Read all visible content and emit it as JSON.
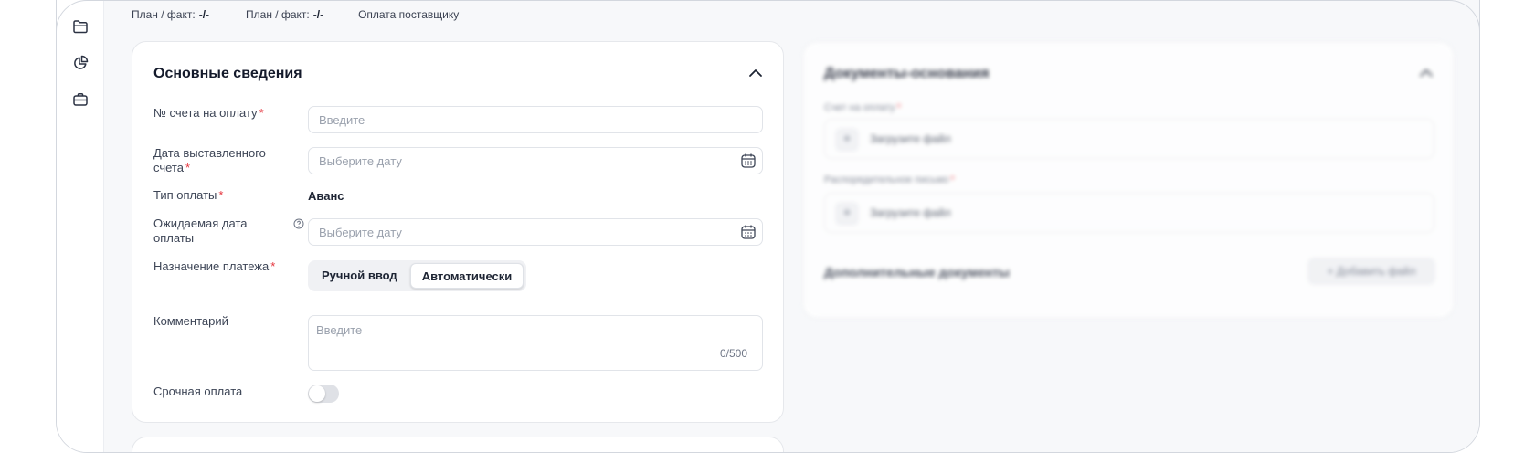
{
  "topbar": {
    "item1_label": "План / факт:",
    "item1_value": "-/-",
    "item2_label": "План / факт:",
    "item2_value": "-/-",
    "item3_label": "Оплата поставщику"
  },
  "main_card": {
    "title": "Основные сведения",
    "invoice_number": {
      "label": "№ счета на оплату",
      "placeholder": "Введите"
    },
    "invoice_date": {
      "label_line1": "Дата выставленного",
      "label_line2": "счета",
      "placeholder": "Выберите дату"
    },
    "payment_type": {
      "label": "Тип оплаты",
      "value": "Аванс"
    },
    "expected_date": {
      "label_line1": "Ожидаемая дата",
      "label_line2": "оплаты",
      "placeholder": "Выберите дату"
    },
    "purpose": {
      "label": "Назначение платежа",
      "options": [
        "Ручной ввод",
        "Автоматически"
      ],
      "selected": "Автоматически"
    },
    "comment": {
      "label": "Комментарий",
      "placeholder": "Введите",
      "counter": "0/500"
    },
    "urgent": {
      "label": "Срочная оплата",
      "enabled": false
    },
    "required_mark": "*"
  },
  "docs_card": {
    "title": "Документы-основания",
    "invoice_label": "Счет на оплату",
    "invoice_upload": "Загрузите файл",
    "letter_label": "Распорядительное письмо",
    "letter_upload": "Загрузите файл",
    "extra_title": "Дополнительные документы",
    "add_button": "Добавить файл"
  },
  "icons": [
    "folder-icon",
    "pie-chart-icon",
    "briefcase-icon",
    "calendar-icon",
    "help-icon",
    "chevron-up-icon",
    "plus-icon"
  ]
}
